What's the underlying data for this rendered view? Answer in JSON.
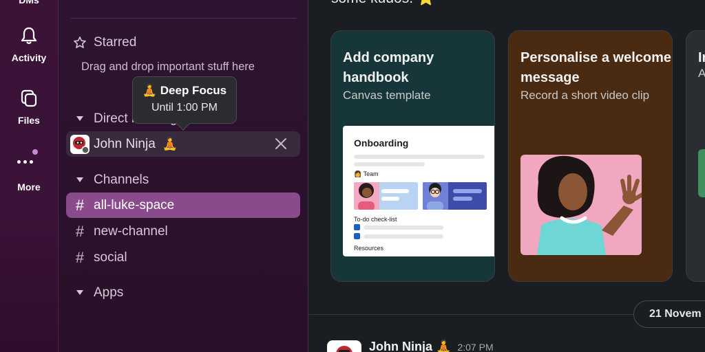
{
  "rail": {
    "dms_label": "DMs",
    "activity_label": "Activity",
    "files_label": "Files",
    "more_label": "More"
  },
  "sidebar": {
    "starred_label": "Starred",
    "starred_hint": "Drag and drop important stuff here",
    "direct_label": "Direct messages",
    "dm_name": "John Ninja",
    "dm_status_emoji": "🧘",
    "channels_label": "Channels",
    "channels": [
      "all-luke-space",
      "new-channel",
      "social"
    ],
    "apps_label": "Apps"
  },
  "tooltip": {
    "emoji": "🧘",
    "title": "Deep Focus",
    "subtitle": "Until 1:00 PM"
  },
  "main": {
    "header_partial": "some kudos.",
    "header_emoji": "⭐",
    "cards": [
      {
        "title": "Add company handbook",
        "subtitle": "Canvas template",
        "bg": "#17363a"
      },
      {
        "title": "Personalise a welcome message",
        "subtitle": "Record a short video clip",
        "bg": "#4a2a10"
      },
      {
        "title": "In",
        "subtitle": "A",
        "bg": "#1c3a26"
      }
    ],
    "doc": {
      "heading": "Onboarding",
      "team_label": "Team",
      "team_emoji": "👩",
      "checklist_label": "To-do check-list",
      "resources_label": "Resources"
    },
    "date_pill": "21 Novem",
    "message": {
      "author": "John Ninja",
      "author_emoji": "🧘",
      "time": "2:07 PM"
    }
  },
  "colors": {
    "rail_bg": "#3a1337",
    "sidebar_bg": "#2d1430",
    "active_channel": "#8a4b8d",
    "main_bg": "#1a1d21"
  }
}
